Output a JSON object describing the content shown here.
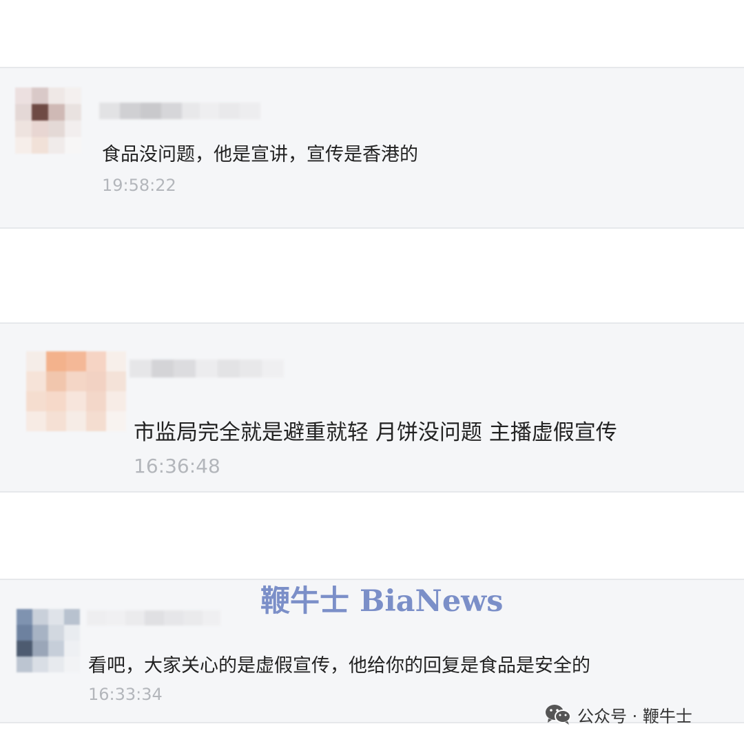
{
  "comments": [
    {
      "text": "食品没问题，他是宣讲，宣传是香港的",
      "time": "19:58:22"
    },
    {
      "text": "市监局完全就是避重就轻  月饼没问题 主播虚假宣传",
      "time": "16:36:48"
    },
    {
      "text": "看吧，大家关心的是虚假宣传，他给你的回复是食品是安全的",
      "time": "16:33:34"
    }
  ],
  "watermark": {
    "brand": "鞭牛士 BiaNews"
  },
  "footer": {
    "credit": "公众号 · 鞭牛士",
    "icon": "wechat-icon"
  },
  "colors": {
    "card_background": "#f5f6f8",
    "timestamp": "#b3b6bb",
    "watermark": "#7b8fc8"
  }
}
